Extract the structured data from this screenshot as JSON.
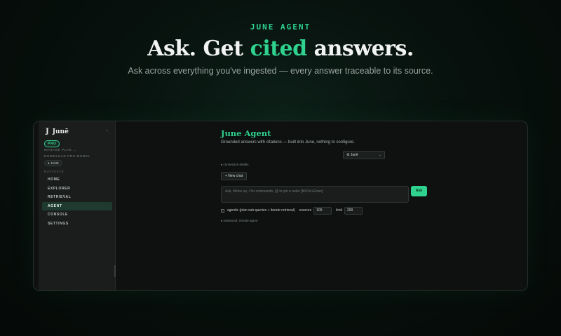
{
  "hero": {
    "eyebrow": "JUNE AGENT",
    "headline_before": "Ask. Get ",
    "headline_accent": "cited",
    "headline_after": " answers.",
    "subline": "Ask across everything you've ingested — every answer traceable to its source."
  },
  "sidebar": {
    "brand_mark": "J",
    "brand_name": "Junē",
    "collapse_icon": "‹",
    "plan_badge": "PRO",
    "manage_plan": "MANAGE PLAN →",
    "download_model": "DOWNLOAD PRO MODEL",
    "model_chip": "● JUNE",
    "nav_label": "NAVIGATE",
    "items": [
      {
        "label": "HOME",
        "active": false
      },
      {
        "label": "EXPLORER",
        "active": false
      },
      {
        "label": "RETRIEVAL",
        "active": false
      },
      {
        "label": "AGENT",
        "active": true
      },
      {
        "label": "CONSOLE",
        "active": false
      },
      {
        "label": "SETTINGS",
        "active": false
      }
    ]
  },
  "main": {
    "title": "June Agent",
    "subtitle": "Grounded answers with citations — built into June, nothing to configure.",
    "model_select": "⚙ Junē",
    "connection_details": "▸ connection details",
    "new_chat": "+ New chat",
    "prompt_placeholder": "Ask, follow up, / for commands, @ to pin a node  [⌘/Ctrl+Enter]",
    "ask_label": "Ask",
    "agentic_label": "agentic (plan sub-queries + iterate retrieval)",
    "sources_label": "sources",
    "sources_value": "100",
    "limit_label": "limit",
    "limit_value": "200",
    "advanced": "▸ Advanced: remote agent"
  },
  "colors": {
    "accent": "#2fd28f",
    "background": "#07110d",
    "sidebar": "#1a1d1c"
  }
}
